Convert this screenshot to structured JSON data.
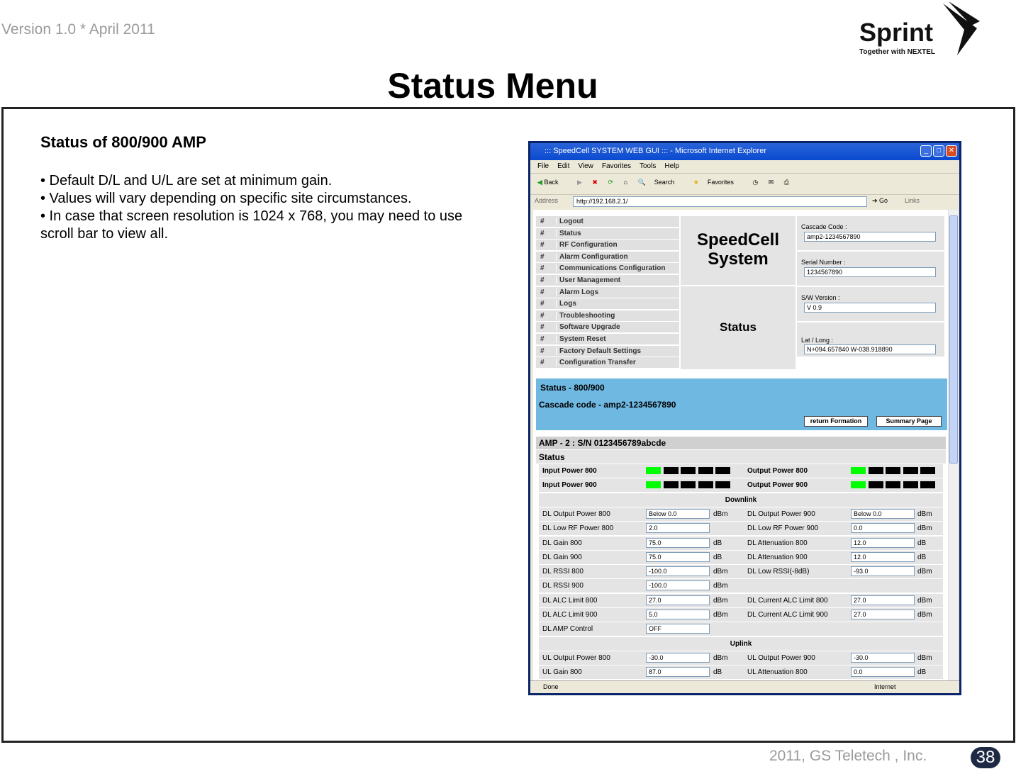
{
  "header": {
    "version": "Version 1.0 * April 2011",
    "logo_text": "Sprint",
    "logo_tagline": "Together with NEXTEL",
    "title": "Status Menu"
  },
  "slide": {
    "subtitle": "Status of 800/900 AMP",
    "bullets": [
      "• Default D/L and U/L are set at minimum gain.",
      "• Values will vary depending on specific site circumstances.",
      "• In case that screen resolution is 1024 x 768, you may need to use scroll bar to view all."
    ]
  },
  "footer": {
    "copyright": "2011, GS Teletech , Inc.",
    "page": "38"
  },
  "browser": {
    "title": "::: SpeedCell SYSTEM WEB GUI ::: - Microsoft Internet Explorer",
    "menu": [
      "File",
      "Edit",
      "View",
      "Favorites",
      "Tools",
      "Help"
    ],
    "toolbar": [
      "Back",
      "Search",
      "Favorites"
    ],
    "address_label": "Address",
    "address": "http://192.168.2.1/",
    "go": "Go",
    "links": "Links",
    "status_left": "Done",
    "status_right": "Internet"
  },
  "nav": {
    "hash": "#",
    "items": [
      "Logout",
      "Status",
      "RF Configuration",
      "Alarm Configuration",
      "Communications Configuration",
      "User Management",
      "Alarm Logs",
      "Logs",
      "Troubleshooting",
      "Software Upgrade",
      "System Reset",
      "Factory Default Settings",
      "Configuration Transfer"
    ]
  },
  "system": {
    "name": "SpeedCell System",
    "page": "Status"
  },
  "info": [
    {
      "label": "Cascade Code :",
      "value": "amp2-1234567890"
    },
    {
      "label": "Serial Number :",
      "value": "1234567890"
    },
    {
      "label": "S/W Version :",
      "value": "V 0.9"
    },
    {
      "label": "Lat / Long :",
      "value": "N+094.657840 W-038.918890"
    }
  ],
  "section": {
    "title": "Status - 800/900",
    "cascade": "Cascade code - amp2-1234567890",
    "buttons": [
      "return Formation",
      "Summary Page"
    ]
  },
  "amp": {
    "header": "AMP - 2 : S/N 0123456789abcde",
    "status_label": "Status",
    "leds": [
      {
        "label": "Input Power 800",
        "lit": 1
      },
      {
        "label": "Output Power 800",
        "lit": 1
      },
      {
        "label": "Input Power 900",
        "lit": 1
      },
      {
        "label": "Output Power 900",
        "lit": 1
      }
    ],
    "colors": {
      "led_on": "#00ff00",
      "led_off": "#000000",
      "section_blue": "#6fb8e2"
    },
    "downlink": "Downlink",
    "uplink": "Uplink",
    "dl_rows": [
      [
        "DL Output Power 800",
        "Below 0.0",
        "dBm",
        "DL Output Power 900",
        "Below 0.0",
        "dBm"
      ],
      [
        "DL Low RF Power 800",
        "2.0",
        "",
        "DL Low RF Power 900",
        "0.0",
        "dBm"
      ],
      [
        "DL Gain 800",
        "75.0",
        "dB",
        "DL Attenuation 800",
        "12.0",
        "dB"
      ],
      [
        "DL Gain 900",
        "75.0",
        "dB",
        "DL Attenuation 900",
        "12.0",
        "dB"
      ],
      [
        "DL RSSI 800",
        "-100.0",
        "dBm",
        "DL Low RSSI(-8dB)",
        "-93.0",
        "dBm"
      ],
      [
        "DL RSSI 900",
        "-100.0",
        "dBm",
        "",
        "",
        ""
      ],
      [
        "DL ALC Limit 800",
        "27.0",
        "dBm",
        "DL Current ALC Limit 800",
        "27.0",
        "dBm"
      ],
      [
        "DL ALC Limit 900",
        "5.0",
        "dBm",
        "DL Current ALC Limit 900",
        "27.0",
        "dBm"
      ],
      [
        "DL AMP Control",
        "OFF",
        "",
        "",
        "",
        ""
      ]
    ],
    "ul_rows": [
      [
        "UL Output Power 800",
        "-30.0",
        "dBm",
        "UL Output Power 900",
        "-30.0",
        "dBm"
      ],
      [
        "UL Gain 800",
        "87.0",
        "dB",
        "UL Attenuation 800",
        "0.0",
        "dB"
      ]
    ]
  }
}
